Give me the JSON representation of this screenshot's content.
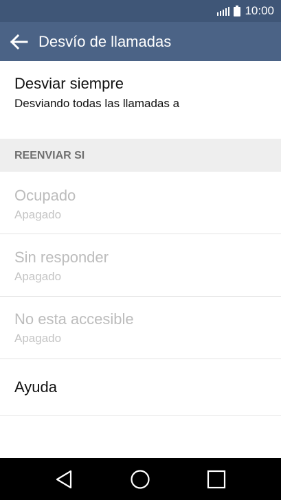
{
  "status_bar": {
    "time": "10:00"
  },
  "app_bar": {
    "title": "Desvío de llamadas"
  },
  "items": {
    "always": {
      "title": "Desviar siempre",
      "subtitle": "Desviando todas las llamadas a"
    },
    "section_header": "REENVIAR SI",
    "busy": {
      "title": "Ocupado",
      "subtitle": "Apagado"
    },
    "no_answer": {
      "title": "Sin responder",
      "subtitle": "Apagado"
    },
    "unreachable": {
      "title": "No esta accesible",
      "subtitle": "Apagado"
    },
    "help": {
      "title": "Ayuda"
    }
  },
  "colors": {
    "status_bar": "#3f5677",
    "app_bar": "#4b6386",
    "section_header_bg": "#eeeeee",
    "disabled_text": "#bcbcbc"
  },
  "icons": {
    "status": [
      "signal-icon",
      "battery-icon"
    ],
    "app_bar": "back-arrow-icon",
    "nav": [
      "back-triangle-icon",
      "home-circle-icon",
      "recents-square-icon"
    ]
  }
}
